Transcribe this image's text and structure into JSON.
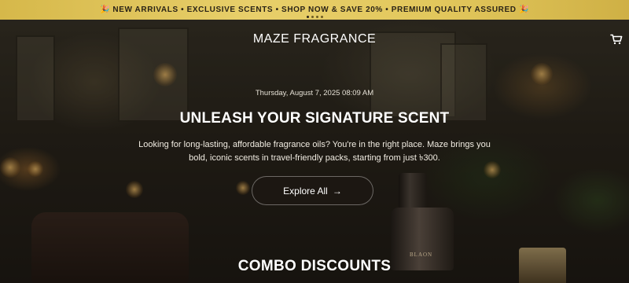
{
  "announcement": {
    "text": "🎉 NEW ARRIVALS • EXCLUSIVE SCENTS • SHOP NOW & SAVE 20% • PREMIUM QUALITY ASSURED 🎉",
    "slides": 4,
    "active_slide": 0
  },
  "header": {
    "brand": "MAZE FRAGRANCE",
    "cart_icon": "shopping-cart-icon"
  },
  "hero": {
    "datetime": "Thursday, August 7, 2025 08:09 AM",
    "headline": "UNLEASH YOUR SIGNATURE SCENT",
    "description_line1": "Looking for long-lasting, affordable fragrance oils? You're in the right place. Maze brings you",
    "description_line2": "bold, iconic scents in travel-friendly packs, starting from just ৳300.",
    "cta_label": "Explore All",
    "cta_icon": "arrow-right-icon",
    "bottle_label": "BLAON"
  },
  "sections": {
    "combo_title": "COMBO DISCOUNTS"
  },
  "colors": {
    "announcement_bg": "#e2c75c",
    "announcement_text": "#2a2316",
    "hero_text": "#ffffff"
  }
}
